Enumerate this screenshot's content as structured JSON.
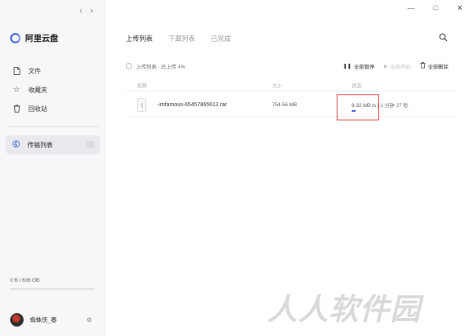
{
  "app": {
    "name": "阿里云盘"
  },
  "sidebar": {
    "items": [
      {
        "label": "文件",
        "icon": "file-icon"
      },
      {
        "label": "收藏夹",
        "icon": "star-icon"
      },
      {
        "label": "回收站",
        "icon": "trash-icon"
      }
    ],
    "transfer": {
      "label": "传输列表",
      "icon": "lightning-icon"
    },
    "storage": {
      "text": "0 B / 636 GB",
      "used_fraction": 0
    },
    "user": {
      "name": "蜘蛛侠_春"
    }
  },
  "tabs": [
    {
      "label": "上传列表",
      "active": true
    },
    {
      "label": "下载列表",
      "active": false
    },
    {
      "label": "已完成",
      "active": false
    }
  ],
  "status": {
    "text": "上传列表 · 已上传 4%"
  },
  "actions": [
    {
      "label": "全部暂停",
      "icon": "pause-icon",
      "enabled": true
    },
    {
      "label": "全部开始",
      "icon": "play-icon",
      "enabled": false
    },
    {
      "label": "全部删除",
      "icon": "trash-icon",
      "enabled": true
    }
  ],
  "table": {
    "headers": {
      "name": "名称",
      "size": "大小",
      "status": "状态"
    },
    "rows": [
      {
        "name": "-imfamous-65457865612.rar",
        "size": "754.56 MB",
        "speed": "8.32 MB /s",
        "remaining": "1 分钟 27 秒",
        "progress": 0.04
      }
    ]
  },
  "watermark": "人人软件园"
}
